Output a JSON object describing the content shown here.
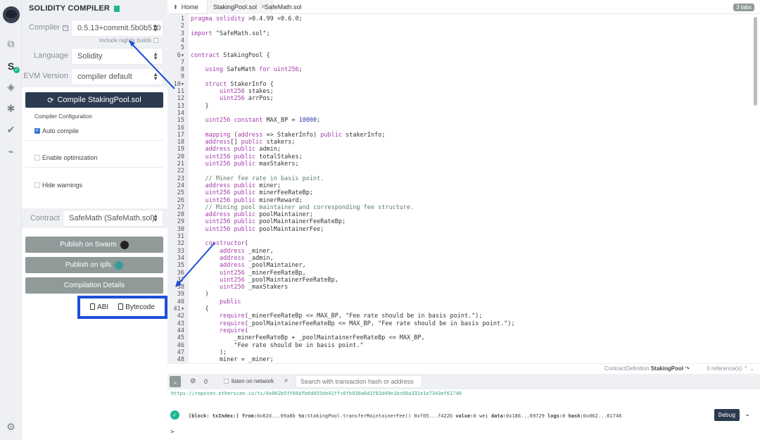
{
  "panel": {
    "title": "SOLIDITY COMPILER",
    "compiler_label": "Compiler",
    "compiler_value": "0.5.13+commit.5b0b510",
    "nightly_label": "Include nightly builds",
    "language_label": "Language",
    "language_value": "Solidity",
    "evm_label": "EVM Version",
    "evm_value": "compiler default",
    "compile_button": "Compile StakingPool.sol",
    "config_title": "Compiler Configuration",
    "auto_compile": {
      "label": "Auto compile",
      "checked": true
    },
    "enable_optimization": {
      "label": "Enable optimization",
      "checked": false
    },
    "hide_warnings": {
      "label": "Hide warnings",
      "checked": false
    },
    "contract_label": "Contract",
    "contract_value": "SafeMath (SafeMath.sol)",
    "publish_swarm": "Publish on Swarm",
    "publish_ipfs": "Publish on Ipfs",
    "compilation_details": "Compilation Details",
    "abi_label": "ABI",
    "bytecode_label": "Bytecode"
  },
  "editor": {
    "tabs": [
      {
        "label": "Home"
      },
      {
        "label": "StakingPool.sol",
        "active": true
      },
      {
        "label": "SafeMath.sol"
      }
    ],
    "tabs_count": "3 tabs",
    "lines": [
      "pragma solidity >0.4.99 <0.6.0;",
      "",
      "import \"SafeMath.sol\";",
      "",
      "",
      "contract StakingPool {",
      "",
      "    using SafeMath for uint256;",
      "",
      "    struct StakerInfo {",
      "        uint256 stakes;",
      "        uint256 arrPos;",
      "    }",
      "",
      "    uint256 constant MAX_BP = 10000;",
      "",
      "    mapping (address => StakerInfo) public stakerInfo;",
      "    address[] public stakers;",
      "    address public admin;",
      "    uint256 public totalStakes;",
      "    uint256 public maxStakers;",
      "",
      "    // Miner fee rate in basis point.",
      "    address public miner;",
      "    uint256 public minerFeeRateBp;",
      "    uint256 public minerReward;",
      "    // Mining pool maintainer and corresponding fee structure.",
      "    address public poolMaintainer;",
      "    uint256 public poolMaintainerFeeRateBp;",
      "    uint256 public poolMaintainerFee;",
      "",
      "    constructor(",
      "        address _miner,",
      "        address _admin,",
      "        address _poolMaintainer,",
      "        uint256 _minerFeeRateBp,",
      "        uint256 _poolMaintainerFeeRateBp,",
      "        uint256 _maxStakers",
      "    )",
      "        public",
      "    {",
      "        require(_minerFeeRateBp <= MAX_BP, \"Fee rate should be in basis point.\");",
      "        require(_poolMaintainerFeeRateBp <= MAX_BP, \"Fee rate should be in basis point.\");",
      "        require(",
      "            _minerFeeRateBp + _poolMaintainerFeeRateBp <= MAX_BP,",
      "            \"Fee rate should be in basis point.\"",
      "        );",
      "        miner = _miner;"
    ],
    "fold_lines": [
      6,
      10,
      41
    ],
    "status_kind": "ContractDefinition",
    "status_name": "StakingPool",
    "references": "0 reference(s)"
  },
  "terminal": {
    "count": "0",
    "listen_label": "listen on network",
    "search_placeholder": "Search with transaction hash or address",
    "url": "https://ropsten.etherscan.io/tx/0x062b5ff66dfb6d455de41ffc6fb930a6d1f83d49e1bc66a331e1e7343ef61746",
    "tx": {
      "block_label": "[block: txIndex:]",
      "from_label": "from:",
      "from": "0x62d...09a8b",
      "to_label": "to:",
      "to": "StakingPool.transferMaintainerFee() 0xf05...f422b",
      "value_label": "value:",
      "value": "0 wei",
      "data_label": "data:",
      "data": "0x186...69729",
      "logs_label": "logs:",
      "logs": "0",
      "hash_label": "hash:",
      "hash": "0x062...61746"
    },
    "debug_button": "Debug",
    "prompt": ">"
  },
  "colors": {
    "accent_dark": "#2b3a4e",
    "success": "#1db794",
    "annotation": "#1d4fd8",
    "grey_button": "#8f9a99"
  }
}
